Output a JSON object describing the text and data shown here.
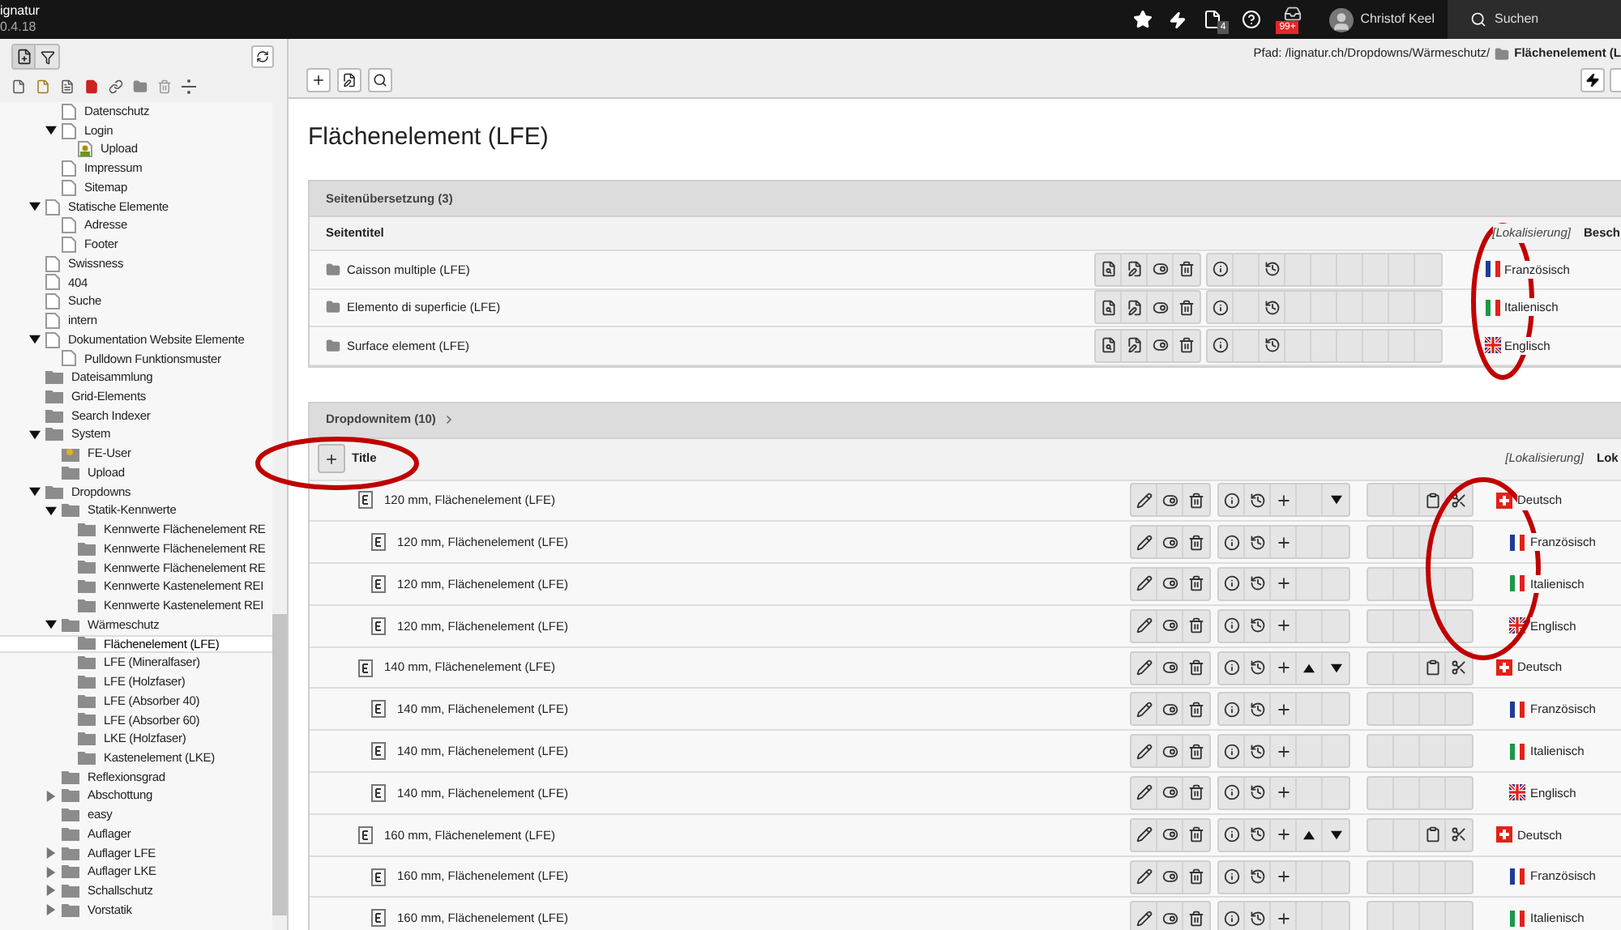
{
  "topbar": {
    "app_name": "ignatur",
    "version": "0.4.18",
    "file_badge": "4",
    "notification_badge": "99+",
    "user": "Christof Keel",
    "search": "Suchen"
  },
  "page_tree": {
    "continued_children": [
      {
        "label": "Datenschutz",
        "kind": "page",
        "selected": false
      },
      {
        "label": "Login",
        "kind": "page",
        "selected": false,
        "expanded": true,
        "children": [
          {
            "label": "Upload",
            "kind": "login",
            "selected": false
          }
        ]
      },
      {
        "label": "Impressum",
        "kind": "page",
        "selected": false
      },
      {
        "label": "Sitemap",
        "kind": "page",
        "selected": false
      }
    ],
    "items": [
      {
        "label": "Statische Elemente",
        "kind": "page",
        "selected": false,
        "expanded": true,
        "children": [
          {
            "label": "Adresse",
            "kind": "page",
            "selected": false
          },
          {
            "label": "Footer",
            "kind": "page",
            "selected": false
          }
        ]
      },
      {
        "label": "Swissness",
        "kind": "page",
        "selected": false
      },
      {
        "label": "404",
        "kind": "page",
        "selected": false
      },
      {
        "label": "Suche",
        "kind": "page",
        "selected": false
      },
      {
        "label": "intern",
        "kind": "page",
        "selected": false
      },
      {
        "label": "Dokumentation Website Elemente",
        "kind": "page",
        "selected": false,
        "expanded": true,
        "children": [
          {
            "label": "Pulldown Funktionsmuster",
            "kind": "page",
            "selected": false
          }
        ]
      },
      {
        "label": "Dateisammlung",
        "kind": "folder",
        "selected": false
      },
      {
        "label": "Grid-Elements",
        "kind": "folder",
        "selected": false
      },
      {
        "label": "Search Indexer",
        "kind": "folder",
        "selected": false
      },
      {
        "label": "System",
        "kind": "folder",
        "selected": false,
        "expanded": true,
        "children": [
          {
            "label": "FE-User",
            "kind": "userfolder",
            "selected": false
          },
          {
            "label": "Upload",
            "kind": "folder",
            "selected": false
          }
        ]
      },
      {
        "label": "Dropdowns",
        "kind": "folder",
        "selected": false,
        "expanded": true,
        "children": [
          {
            "label": "Statik-Kennwerte",
            "kind": "folder",
            "selected": false,
            "expanded": true,
            "children": [
              {
                "label": "Kennwerte Flächenelement RE",
                "kind": "folder",
                "selected": false
              },
              {
                "label": "Kennwerte Flächenelement RE",
                "kind": "folder",
                "selected": false
              },
              {
                "label": "Kennwerte Flächenelement RE",
                "kind": "folder",
                "selected": false
              },
              {
                "label": "Kennwerte Kastenelement REI",
                "kind": "folder",
                "selected": false
              },
              {
                "label": "Kennwerte Kastenelement REI",
                "kind": "folder",
                "selected": false
              }
            ]
          },
          {
            "label": "Wärmeschutz",
            "kind": "folder",
            "selected": false,
            "expanded": true,
            "children": [
              {
                "label": "Flächenelement (LFE)",
                "kind": "folder",
                "selected": true
              },
              {
                "label": "LFE (Mineralfaser)",
                "kind": "folder",
                "selected": false
              },
              {
                "label": "LFE (Holzfaser)",
                "kind": "folder",
                "selected": false
              },
              {
                "label": "LFE (Absorber 40)",
                "kind": "folder",
                "selected": false
              },
              {
                "label": "LFE (Absorber 60)",
                "kind": "folder",
                "selected": false
              },
              {
                "label": "LKE (Holzfaser)",
                "kind": "folder",
                "selected": false
              },
              {
                "label": "Kastenelement (LKE)",
                "kind": "folder",
                "selected": false
              }
            ]
          },
          {
            "label": "Reflexionsgrad",
            "kind": "folder",
            "selected": false
          },
          {
            "label": "Abschottung",
            "kind": "folder",
            "selected": false,
            "expanded": false
          },
          {
            "label": "easy",
            "kind": "folder",
            "selected": false
          },
          {
            "label": "Auflager",
            "kind": "folder",
            "selected": false
          },
          {
            "label": "Auflager LFE",
            "kind": "folder",
            "selected": false,
            "expanded": false
          },
          {
            "label": "Auflager LKE",
            "kind": "folder",
            "selected": false,
            "expanded": false
          },
          {
            "label": "Schallschutz",
            "kind": "folder",
            "selected": false,
            "expanded": false
          },
          {
            "label": "Vorstatik",
            "kind": "folder",
            "selected": false,
            "expanded": false
          }
        ]
      }
    ]
  },
  "docheader": {
    "path": "Pfad: /lignatur.ch/Dropdowns/Wärmeschutz/",
    "current": "Flächenelement (L"
  },
  "title": "Flächenelement (LFE)",
  "translations": {
    "heading": "Seitenübersetzung (3)",
    "columns": [
      "Seitentitel",
      "[Lokalisierung]",
      "Besch"
    ],
    "rows": [
      {
        "title": "Caisson multiple (LFE)",
        "kind": "fr",
        "language": "Französisch"
      },
      {
        "title": "Elemento di superficie (LFE)",
        "kind": "it",
        "language": "Italienisch"
      },
      {
        "title": "Surface element (LFE)",
        "kind": "gb",
        "language": "Englisch"
      }
    ]
  },
  "items": {
    "heading": "Dropdownitem (10)",
    "columns": [
      "Title",
      "[Lokalisierung]",
      "Lok"
    ],
    "rows": [
      {
        "title": "120 mm, Flächenelement (LFE)",
        "kind": "ch",
        "language": "Deutsch",
        "move_up": false,
        "move_down": true,
        "translations": [
          {
            "title": "120 mm, Flächenelement (LFE)",
            "kind": "fr",
            "language": "Französisch"
          },
          {
            "title": "120 mm, Flächenelement (LFE)",
            "kind": "it",
            "language": "Italienisch"
          },
          {
            "title": "120 mm, Flächenelement (LFE)",
            "kind": "gb",
            "language": "Englisch"
          }
        ]
      },
      {
        "title": "140 mm, Flächenelement (LFE)",
        "kind": "ch",
        "language": "Deutsch",
        "move_up": true,
        "move_down": true,
        "translations": [
          {
            "title": "140 mm, Flächenelement (LFE)",
            "kind": "fr",
            "language": "Französisch"
          },
          {
            "title": "140 mm, Flächenelement (LFE)",
            "kind": "it",
            "language": "Italienisch"
          },
          {
            "title": "140 mm, Flächenelement (LFE)",
            "kind": "gb",
            "language": "Englisch"
          }
        ]
      },
      {
        "title": "160 mm, Flächenelement (LFE)",
        "kind": "ch",
        "language": "Deutsch",
        "move_up": true,
        "move_down": true,
        "translations": [
          {
            "title": "160 mm, Flächenelement (LFE)",
            "kind": "fr",
            "language": "Französisch"
          },
          {
            "title": "160 mm, Flächenelement (LFE)",
            "kind": "it",
            "language": "Italienisch"
          }
        ]
      }
    ]
  }
}
